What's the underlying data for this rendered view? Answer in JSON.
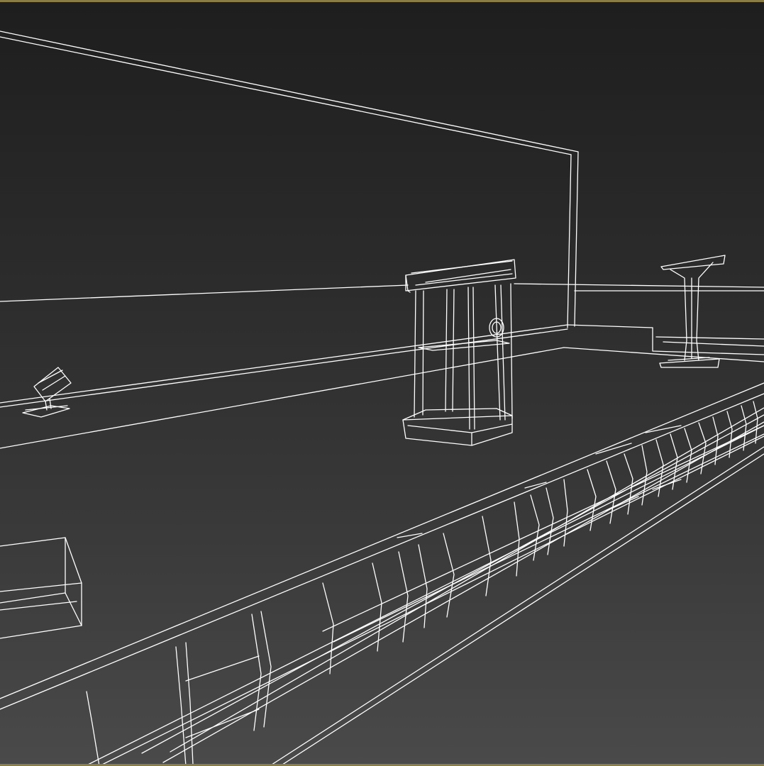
{
  "viewport": {
    "render_mode": "wireframe",
    "background_color": "#2b2b2b",
    "wire_color": "#ffffff",
    "active_border_color": "#8a7d45"
  }
}
